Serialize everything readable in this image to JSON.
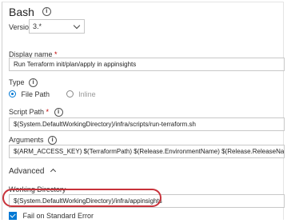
{
  "task": {
    "title": "Bash",
    "version_label": "Version",
    "version_value": "3.*"
  },
  "display_name": {
    "label": "Display name",
    "required_mark": "*",
    "value": "Run Terraform init/plan/apply in appinsights"
  },
  "type": {
    "label": "Type",
    "options": [
      {
        "label": "File Path",
        "selected": true
      },
      {
        "label": "Inline",
        "selected": false
      }
    ]
  },
  "script_path": {
    "label": "Script Path",
    "required_mark": "*",
    "value": "$(System.DefaultWorkingDirectory)/infra/scripts/run-terraform.sh"
  },
  "arguments": {
    "label": "Arguments",
    "value": "$(ARM_ACCESS_KEY) $(TerraformPath) $(Release.EnvironmentName) $(Release.ReleaseName)"
  },
  "advanced": {
    "label": "Advanced",
    "working_directory_label": "Working Directory",
    "working_directory_value": "$(System.DefaultWorkingDirectory)/infra/appinsights",
    "fail_on_stderr_label": "Fail on Standard Error",
    "fail_on_stderr_checked": true
  },
  "icons": {
    "info": "info-icon",
    "highlight_color": "#c8323a",
    "accent_color": "#0078d4"
  }
}
